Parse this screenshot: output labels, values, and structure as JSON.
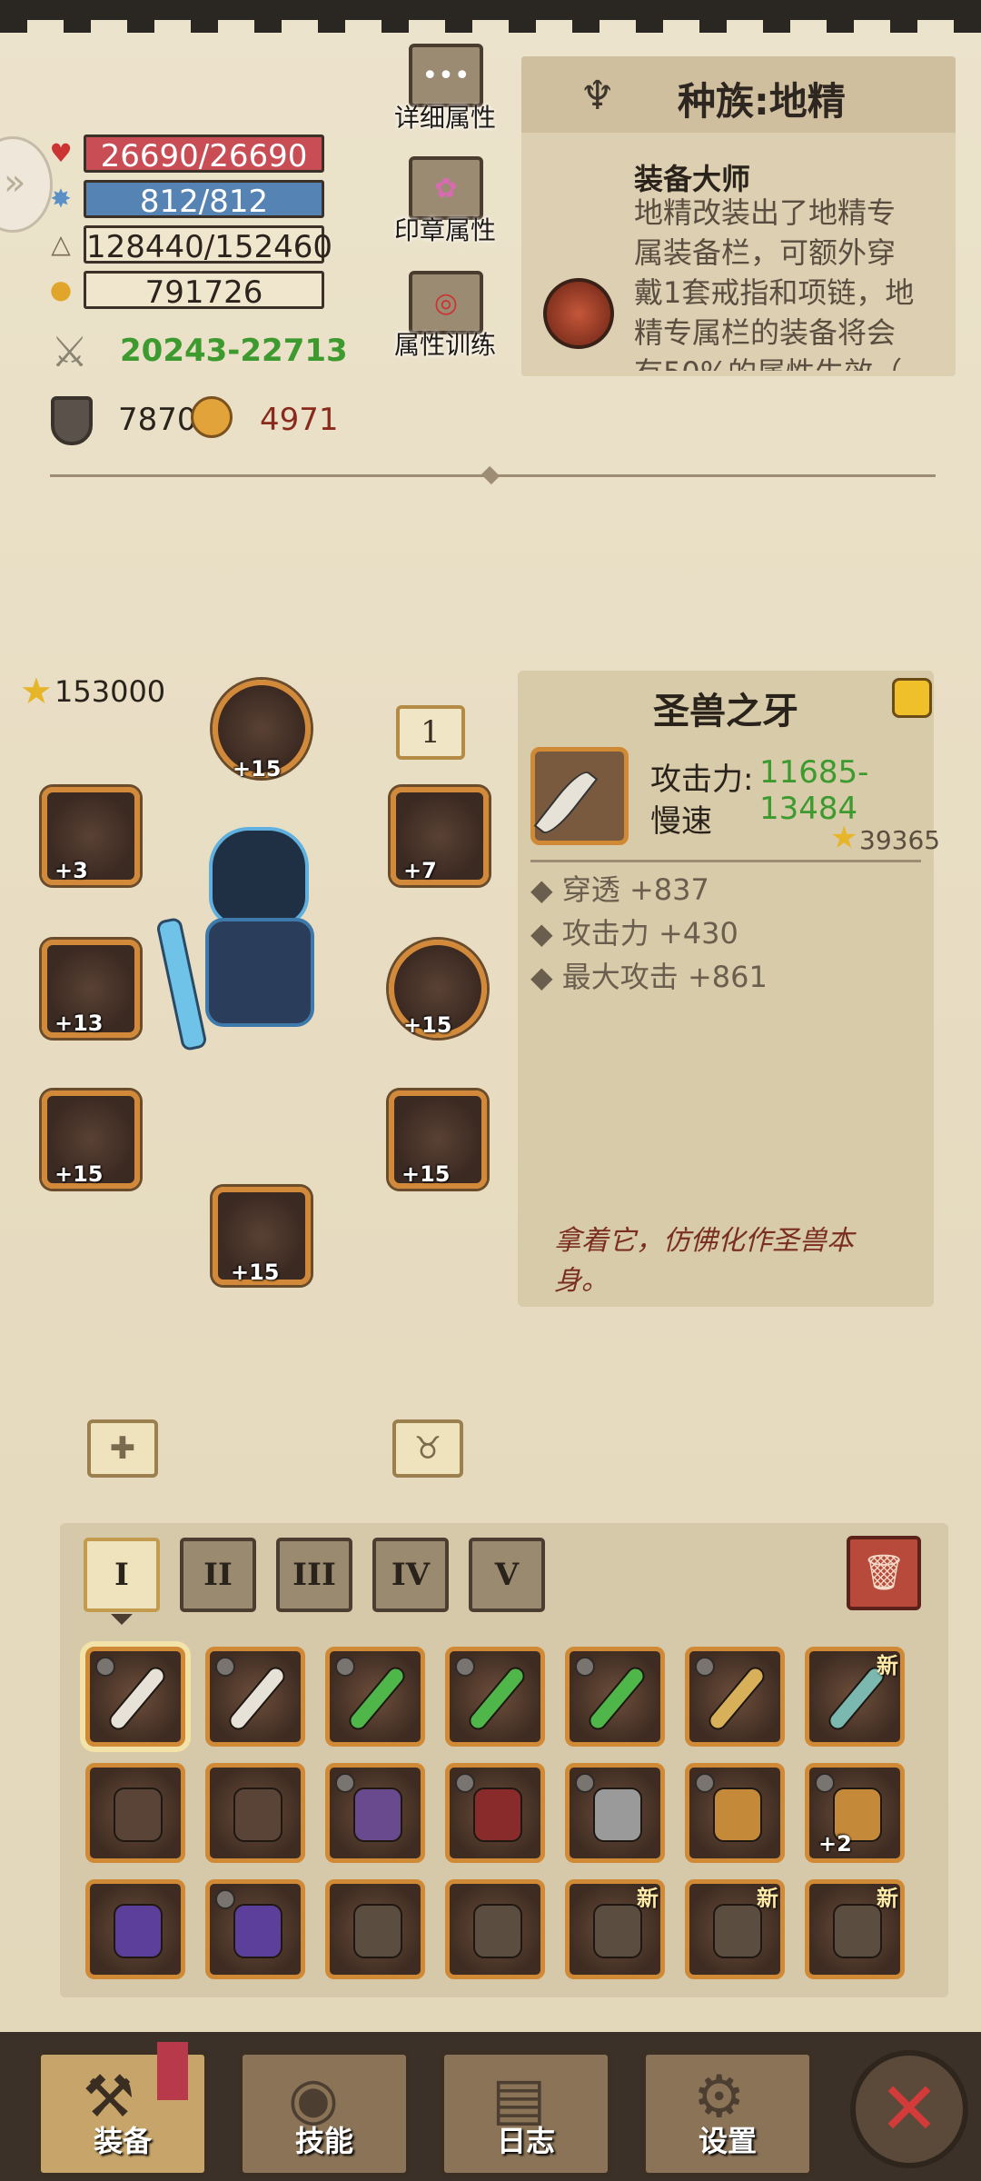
{
  "stats": {
    "hp": "26690/26690",
    "mp": "812/812",
    "exp": "128440/152460",
    "gold": "791726",
    "attack_range": "20243-22713",
    "defense": "7870",
    "magic_res": "4971"
  },
  "side_buttons": {
    "detail": "详细属性",
    "seal": "印章属性",
    "training": "属性训练"
  },
  "race": {
    "title": "种族:地精",
    "skill_name": "装备大师",
    "skill_desc": "地精改装出了地精专属装备栏，可额外穿戴1套戒指和项链，地精专属栏的装备将会有50%的属性生效（"
  },
  "equipment": {
    "power": "153000",
    "set_badge": "1",
    "slots": [
      {
        "name": "helmet",
        "plus": "+15"
      },
      {
        "name": "ring",
        "plus": "+3"
      },
      {
        "name": "shoulder",
        "plus": "+7"
      },
      {
        "name": "weapon",
        "plus": "+13"
      },
      {
        "name": "armor",
        "plus": "+15"
      },
      {
        "name": "gloves",
        "plus": "+15"
      },
      {
        "name": "pants",
        "plus": "+15"
      },
      {
        "name": "boots",
        "plus": "+15"
      }
    ]
  },
  "item": {
    "name": "圣兽之牙",
    "attack_label": "攻击力:",
    "attack_value": "11685-13484",
    "speed": "慢速",
    "score": "39365",
    "bonuses": [
      "穿透 +837",
      "攻击力 +430",
      "最大攻击 +861"
    ],
    "flavor": "拿着它，仿佛化作圣兽本身。"
  },
  "tabs": [
    "I",
    "II",
    "III",
    "IV",
    "V"
  ],
  "inventory_rows": [
    [
      {
        "type": "curved-blade",
        "locked": true,
        "new": false,
        "selected": true
      },
      {
        "type": "curved-blade",
        "locked": true,
        "new": false
      },
      {
        "type": "green-blade",
        "locked": true,
        "new": false
      },
      {
        "type": "green-blade",
        "locked": true,
        "new": false
      },
      {
        "type": "green-blade",
        "locked": true,
        "new": false
      },
      {
        "type": "dagger",
        "locked": true,
        "new": false
      },
      {
        "type": "mace",
        "locked": false,
        "new": true
      }
    ],
    [
      {
        "type": "beast-armor",
        "locked": false,
        "new": false
      },
      {
        "type": "beast-armor",
        "locked": false,
        "new": false
      },
      {
        "type": "purple-helm",
        "locked": true,
        "new": false
      },
      {
        "type": "hood",
        "locked": true,
        "new": false
      },
      {
        "type": "knight-helm",
        "locked": true,
        "new": false
      },
      {
        "type": "belt",
        "locked": true,
        "new": false
      },
      {
        "type": "belt",
        "locked": true,
        "new": false,
        "plus": "+2"
      }
    ],
    [
      {
        "type": "purple-armor",
        "locked": false,
        "new": false
      },
      {
        "type": "purple-armor",
        "locked": true,
        "new": false
      },
      {
        "type": "unknown-gear",
        "locked": false,
        "new": false
      },
      {
        "type": "unknown-gear",
        "locked": false,
        "new": false
      },
      {
        "type": "unknown-gear",
        "locked": false,
        "new": true
      },
      {
        "type": "unknown-gear",
        "locked": false,
        "new": true
      },
      {
        "type": "unknown-gear",
        "locked": false,
        "new": true
      }
    ]
  ],
  "new_label": "新",
  "nav": {
    "equip": "装备",
    "skills": "技能",
    "log": "日志",
    "settings": "设置"
  },
  "colors": {
    "hp_bar": "#c94d55",
    "mp_bar": "#5583b4",
    "attack_green": "#3d9a2f",
    "magic_red": "#8a2a1c",
    "slot_border": "#d08935",
    "close_red": "#d33a3a"
  }
}
